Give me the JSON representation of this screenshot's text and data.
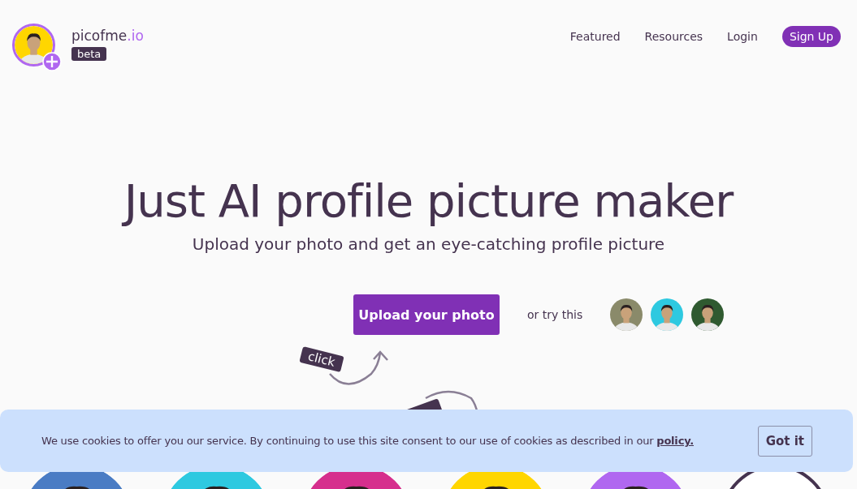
{
  "header": {
    "brand_name": "picofme",
    "brand_suffix": ".io",
    "badge": "beta",
    "nav": [
      {
        "label": "Featured",
        "kind": "link"
      },
      {
        "label": "Resources",
        "kind": "link"
      },
      {
        "label": "Login",
        "kind": "link"
      },
      {
        "label": "Sign Up",
        "kind": "button"
      }
    ]
  },
  "hero": {
    "title": "Just AI profile picture maker",
    "subtitle": "Upload your photo and get an eye-catching profile picture",
    "upload_button": "Upload your photo",
    "try_label": "or try this",
    "samples": [
      {
        "kind": "picture",
        "color": "#8a8a6a"
      },
      {
        "kind": "picture",
        "color": "#2ec9e0"
      },
      {
        "kind": "picture",
        "color": "#2f5a30"
      }
    ],
    "tags": [
      "click"
    ]
  },
  "gallery": [
    {
      "kind": "picture",
      "color": "#4a7cc4"
    },
    {
      "kind": "picture",
      "color": "#2ec9e0"
    },
    {
      "kind": "picture",
      "color": "#d62f8d"
    },
    {
      "kind": "picture",
      "color": "#ffd600"
    },
    {
      "kind": "picture",
      "color": "#b067f0"
    },
    {
      "kind": "ring",
      "color": "#45334f"
    }
  ],
  "cookie_banner": {
    "text": "We use cookies to offer you our service. By continuing to use this site consent to our use of cookies as described in our",
    "link": "policy.",
    "button": "Got it"
  }
}
